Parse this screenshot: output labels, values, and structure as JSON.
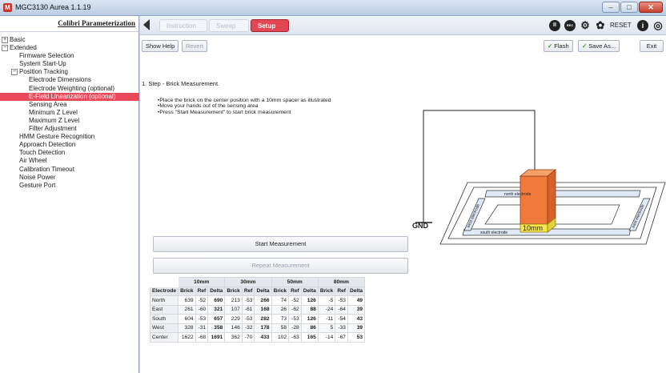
{
  "window": {
    "title": "MGC3130 Aurea 1.1.19",
    "minimize": "–",
    "maximize": "□",
    "close": "✕"
  },
  "sidebar": {
    "header": "Colibri Parameterization",
    "items": [
      {
        "label": "Basic",
        "toggle": "+"
      },
      {
        "label": "Extended",
        "toggle": "−"
      },
      {
        "label": "Firmware Selection"
      },
      {
        "label": "System Start-Up"
      },
      {
        "label": "Position Tracking",
        "toggle": "−"
      },
      {
        "label": "Electrode Dimensions"
      },
      {
        "label": "Electrode Weighting (optional)"
      },
      {
        "label": "E-Field Linearization (optional)"
      },
      {
        "label": "Sensing Area"
      },
      {
        "label": "Minimum Z Level"
      },
      {
        "label": "Maximum Z Level"
      },
      {
        "label": "Filter Adjustment"
      },
      {
        "label": "HMM Gesture Recognition"
      },
      {
        "label": "Approach Detection"
      },
      {
        "label": "Touch Detection"
      },
      {
        "label": "Air Wheel"
      },
      {
        "label": "Calibration Timeout"
      },
      {
        "label": "Noise Power"
      },
      {
        "label": "Gesture Port"
      }
    ]
  },
  "tabs": [
    {
      "label": "Instruction"
    },
    {
      "label": "Sweep"
    },
    {
      "label": "Setup"
    }
  ],
  "toolbar_icons": {
    "pause": "II",
    "rec": "REC",
    "usb": "⚙",
    "gear": "✿",
    "reset": "RESET",
    "info": "i",
    "globe": "◎"
  },
  "actions": {
    "show_help": "Show Help",
    "revert": "Revert",
    "flash": "Flash",
    "save_as": "Save As...",
    "exit": "Exit"
  },
  "step": {
    "title": "1. Step - Brick Measurement.",
    "instructions": [
      "•Place the brick on the center position with a 10mm spacer as illustrated",
      "•Move your hands out of the sensing area",
      "•Press \"Start Measurement\" to start brick measurement"
    ]
  },
  "buttons": {
    "start": "Start Measurement",
    "repeat": "Repeat Measurement"
  },
  "table": {
    "groups": [
      "10mm",
      "30mm",
      "50mm",
      "80mm"
    ],
    "columns": [
      "Electrode",
      "Brick",
      "Ref",
      "Delta",
      "Brick",
      "Ref",
      "Delta",
      "Brick",
      "Ref",
      "Delta",
      "Brick",
      "Ref",
      "Delta"
    ],
    "rows": [
      {
        "name": "North",
        "cells": [
          "639",
          "-52",
          "690",
          "213",
          "-53",
          "266",
          "74",
          "-52",
          "126",
          "-5",
          "-53",
          "49"
        ]
      },
      {
        "name": "East",
        "cells": [
          "261",
          "-60",
          "321",
          "107",
          "-61",
          "168",
          "26",
          "-62",
          "88",
          "-24",
          "-64",
          "39"
        ]
      },
      {
        "name": "South",
        "cells": [
          "604",
          "-53",
          "657",
          "229",
          "-53",
          "282",
          "73",
          "-53",
          "126",
          "-11",
          "-54",
          "43"
        ]
      },
      {
        "name": "West",
        "cells": [
          "328",
          "-31",
          "358",
          "146",
          "-32",
          "178",
          "58",
          "-28",
          "86",
          "5",
          "-33",
          "39"
        ]
      },
      {
        "name": "Center",
        "cells": [
          "1622",
          "-68",
          "1691",
          "362",
          "-70",
          "433",
          "102",
          "-63",
          "165",
          "-14",
          "-67",
          "53"
        ]
      }
    ]
  },
  "diagram": {
    "gnd": "GND",
    "spacer": "10mm",
    "north": "north electrode",
    "south": "south electrode",
    "west": "west electrode",
    "east": "east electrode",
    "brick_color": "#f07a3c",
    "spacer_color": "#f5e64a"
  }
}
